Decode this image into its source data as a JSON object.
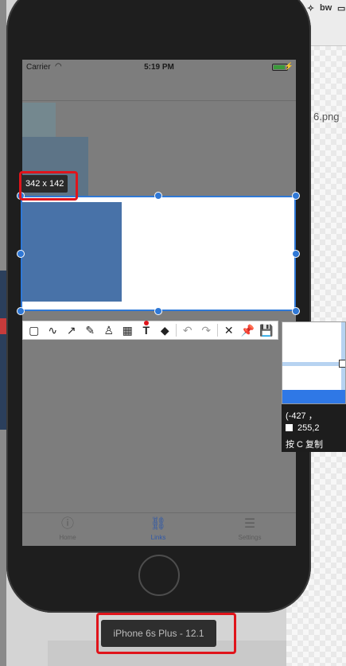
{
  "desktop": {
    "filename": "6.png",
    "top_icons": [
      "bw"
    ]
  },
  "statusbar": {
    "carrier": "Carrier",
    "time": "5:19 PM"
  },
  "tabbar": {
    "tabs": [
      {
        "label": "Home",
        "icon": "info-icon"
      },
      {
        "label": "Links",
        "icon": "link-icon"
      },
      {
        "label": "Settings",
        "icon": "sliders-icon"
      }
    ],
    "active": "Links"
  },
  "selection": {
    "size_label": "342 x 142"
  },
  "toolbar": {
    "tools": [
      "rectangle-tool",
      "curve-tool",
      "arrow-tool",
      "pencil-tool",
      "highlighter-tool",
      "mosaic-tool",
      "text-tool",
      "eraser-tool",
      "undo",
      "redo",
      "cancel",
      "pin",
      "save"
    ]
  },
  "magnifier": {
    "coords": "(-427 ，",
    "color_value": "255,2",
    "hint": "按 C 复制"
  },
  "device": {
    "label": "iPhone 6s Plus - 12.1"
  },
  "colors": {
    "accent": "#2f78d6",
    "highlight": "#e0141b",
    "selected_image": "#4872a8"
  }
}
